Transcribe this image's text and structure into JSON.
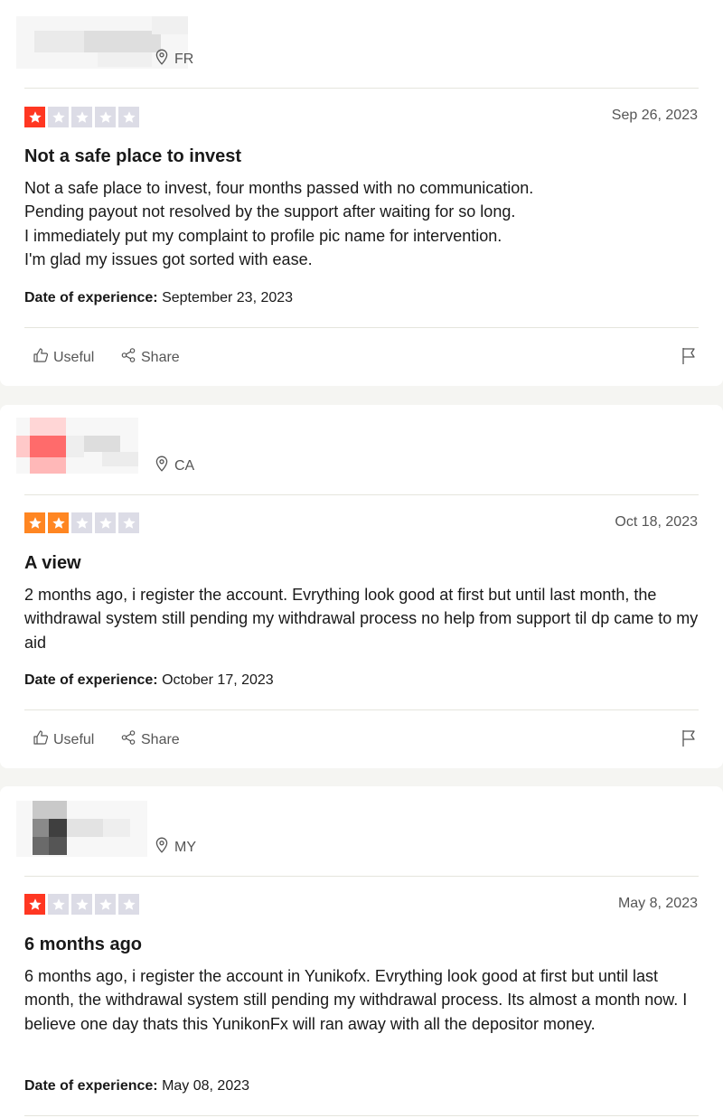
{
  "reviews": [
    {
      "country": "FR",
      "stars": 1,
      "star_color": "#ff3722",
      "date": "Sep 26, 2023",
      "title": "Not a safe place to invest",
      "body": "Not a safe place to invest, four months passed with no communication.\nPending payout not resolved by the support after waiting for so long.\nI immediately put my complaint to profile pic name for intervention.\nI'm glad my issues got sorted with ease.",
      "experience_label": "Date of experience:",
      "experience_date": "September 23, 2023",
      "useful_label": "Useful",
      "share_label": "Share"
    },
    {
      "country": "CA",
      "stars": 2,
      "star_color": "#ff8622",
      "date": "Oct 18, 2023",
      "title": "A view",
      "body": "2 months ago, i register the account. Evrything look good at first but until last month, the withdrawal system still pending my withdrawal process no help from support til dp came to my aid",
      "experience_label": "Date of experience:",
      "experience_date": "October 17, 2023",
      "useful_label": "Useful",
      "share_label": "Share"
    },
    {
      "country": "MY",
      "stars": 1,
      "star_color": "#ff3722",
      "date": "May 8, 2023",
      "title": "6 months ago",
      "body": "6 months ago, i register the account in Yunikofx. Evrything look good at first but until last month, the withdrawal system still pending my withdrawal process. Its almost a month now. I believe one day thats this YunikonFx will ran away with all the depositor money.",
      "experience_label": "Date of experience:",
      "experience_date": "May 08, 2023"
    }
  ],
  "colors": {
    "empty_star": "#dcdce6",
    "muted_text": "#555555",
    "divider": "#e5e5dd"
  },
  "icons": {
    "location": "location-pin-icon",
    "useful": "thumbs-up-icon",
    "share": "share-icon",
    "flag": "flag-icon",
    "star": "star-icon"
  }
}
